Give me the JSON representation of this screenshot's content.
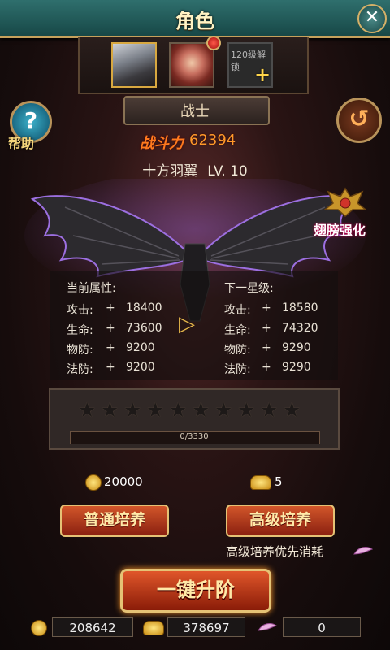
{
  "title": "角色",
  "close_label": "✕",
  "portraits": {
    "slot3_lock_text": "120级解锁",
    "plus": "+"
  },
  "class_tab": "战士",
  "help": {
    "icon": "?",
    "label": "帮助"
  },
  "return_icon": "↺",
  "power": {
    "label": "战斗力",
    "value": "62394"
  },
  "wing": {
    "name": "十方羽翼",
    "level": "LV. 10"
  },
  "enhance_label": "翅膀强化",
  "stats": {
    "current_header": "当前属性:",
    "next_header": "下一星级:",
    "rows": [
      {
        "label": "攻击:",
        "sign": "+",
        "current": "18400",
        "next": "18580"
      },
      {
        "label": "生命:",
        "sign": "+",
        "current": "73600",
        "next": "74320"
      },
      {
        "label": "物防:",
        "sign": "+",
        "current": "9200",
        "next": "9290"
      },
      {
        "label": "法防:",
        "sign": "+",
        "current": "9200",
        "next": "9290"
      }
    ]
  },
  "stars": {
    "lit": 0,
    "total": 10
  },
  "progress": {
    "text": "0/3330",
    "fraction": 0
  },
  "costs": {
    "coins": "20000",
    "gold": "5"
  },
  "buttons": {
    "normal": "普通培养",
    "advanced": "高级培养",
    "one_click": "一键升阶"
  },
  "priority_text": "高级培养优先消耗",
  "resources": {
    "coins": "208642",
    "gold": "378697",
    "feathers": "0"
  },
  "colors": {
    "accent_gold": "#e5c275",
    "title_bar": "#2f6f6d",
    "button_red": "#b8381a"
  }
}
